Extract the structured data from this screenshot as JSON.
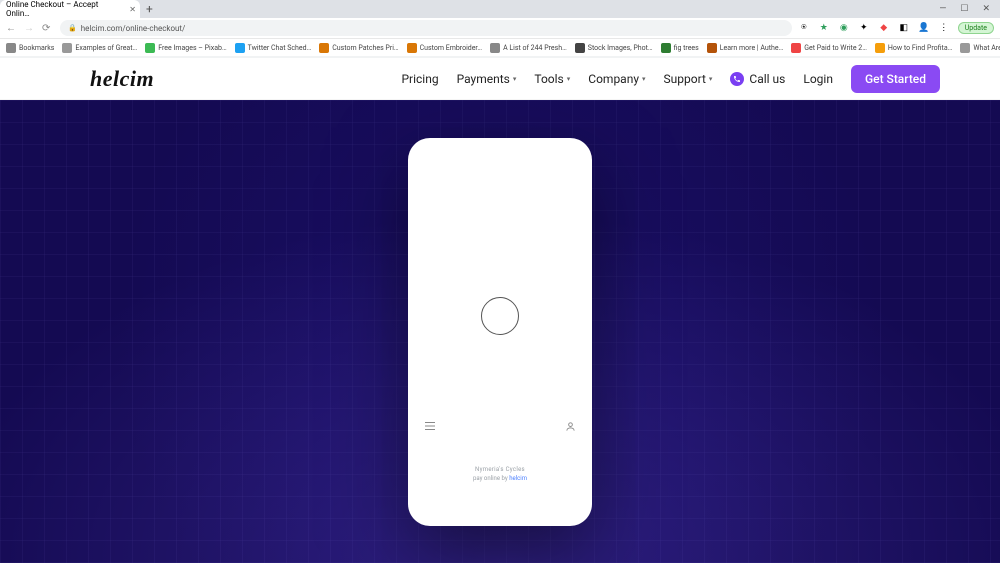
{
  "browser": {
    "tab_title": "Online Checkout – Accept Onlin…",
    "url": "helcim.com/online-checkout/",
    "update_label": "Update",
    "bookmarks": [
      {
        "label": "Bookmarks",
        "color": "#888"
      },
      {
        "label": "Examples of Great…",
        "color": "#999"
      },
      {
        "label": "Free Images – Pixab…",
        "color": "#3cba54"
      },
      {
        "label": "Twitter Chat Sched…",
        "color": "#1da1f2"
      },
      {
        "label": "Custom Patches Pri…",
        "color": "#d97706"
      },
      {
        "label": "Custom Embroider…",
        "color": "#d97706"
      },
      {
        "label": "A List of 244 Presh…",
        "color": "#888"
      },
      {
        "label": "Stock Images, Phot…",
        "color": "#444"
      },
      {
        "label": "fig trees",
        "color": "#2e7d32"
      },
      {
        "label": "Learn more | Authe…",
        "color": "#b45309"
      },
      {
        "label": "Get Paid to Write 2…",
        "color": "#ef4444"
      },
      {
        "label": "How to Find Profita…",
        "color": "#f59e0b"
      },
      {
        "label": "What Are UTM Cod…",
        "color": "#999"
      }
    ]
  },
  "nav": {
    "logo": "helcim",
    "links": {
      "pricing": "Pricing",
      "payments": "Payments",
      "tools": "Tools",
      "company": "Company",
      "support": "Support"
    },
    "callus": "Call us",
    "login": "Login",
    "cta": "Get Started"
  },
  "phone": {
    "meta1": "Nymeria's Cycles",
    "meta2_prefix": "pay online by ",
    "meta2_link": "helcim"
  }
}
